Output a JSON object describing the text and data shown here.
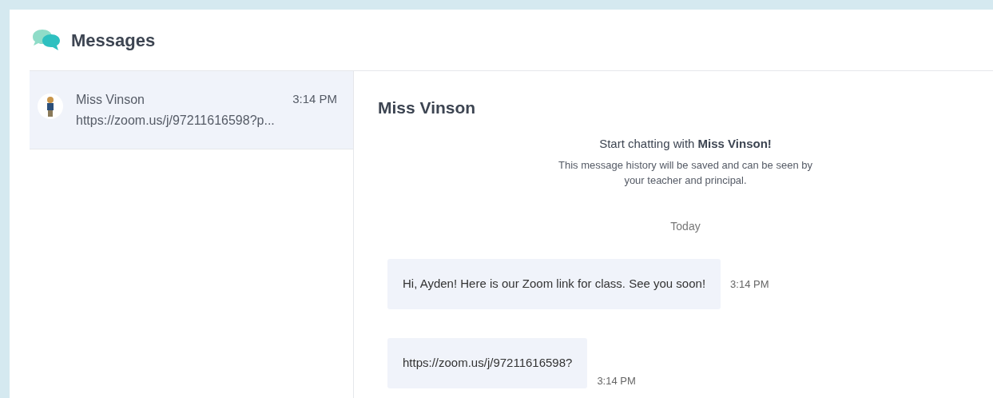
{
  "header": {
    "title": "Messages"
  },
  "conversations": [
    {
      "name": "Miss Vinson",
      "time": "3:14 PM",
      "preview": "https://zoom.us/j/97211616598?p...",
      "selected": true
    }
  ],
  "chat": {
    "title": "Miss Vinson",
    "intro": "Start chatting with **Miss Vinson!**",
    "notice": "This message history will be saved and can be seen by your teacher and principal.",
    "day": "Today",
    "messages": [
      {
        "text": "Hi, Ayden! Here is our Zoom link for class. See you soon!",
        "time": "3:14 PM"
      },
      {
        "text": "https://zoom.us/j/97211616598?",
        "time": "3:14 PM"
      }
    ]
  }
}
